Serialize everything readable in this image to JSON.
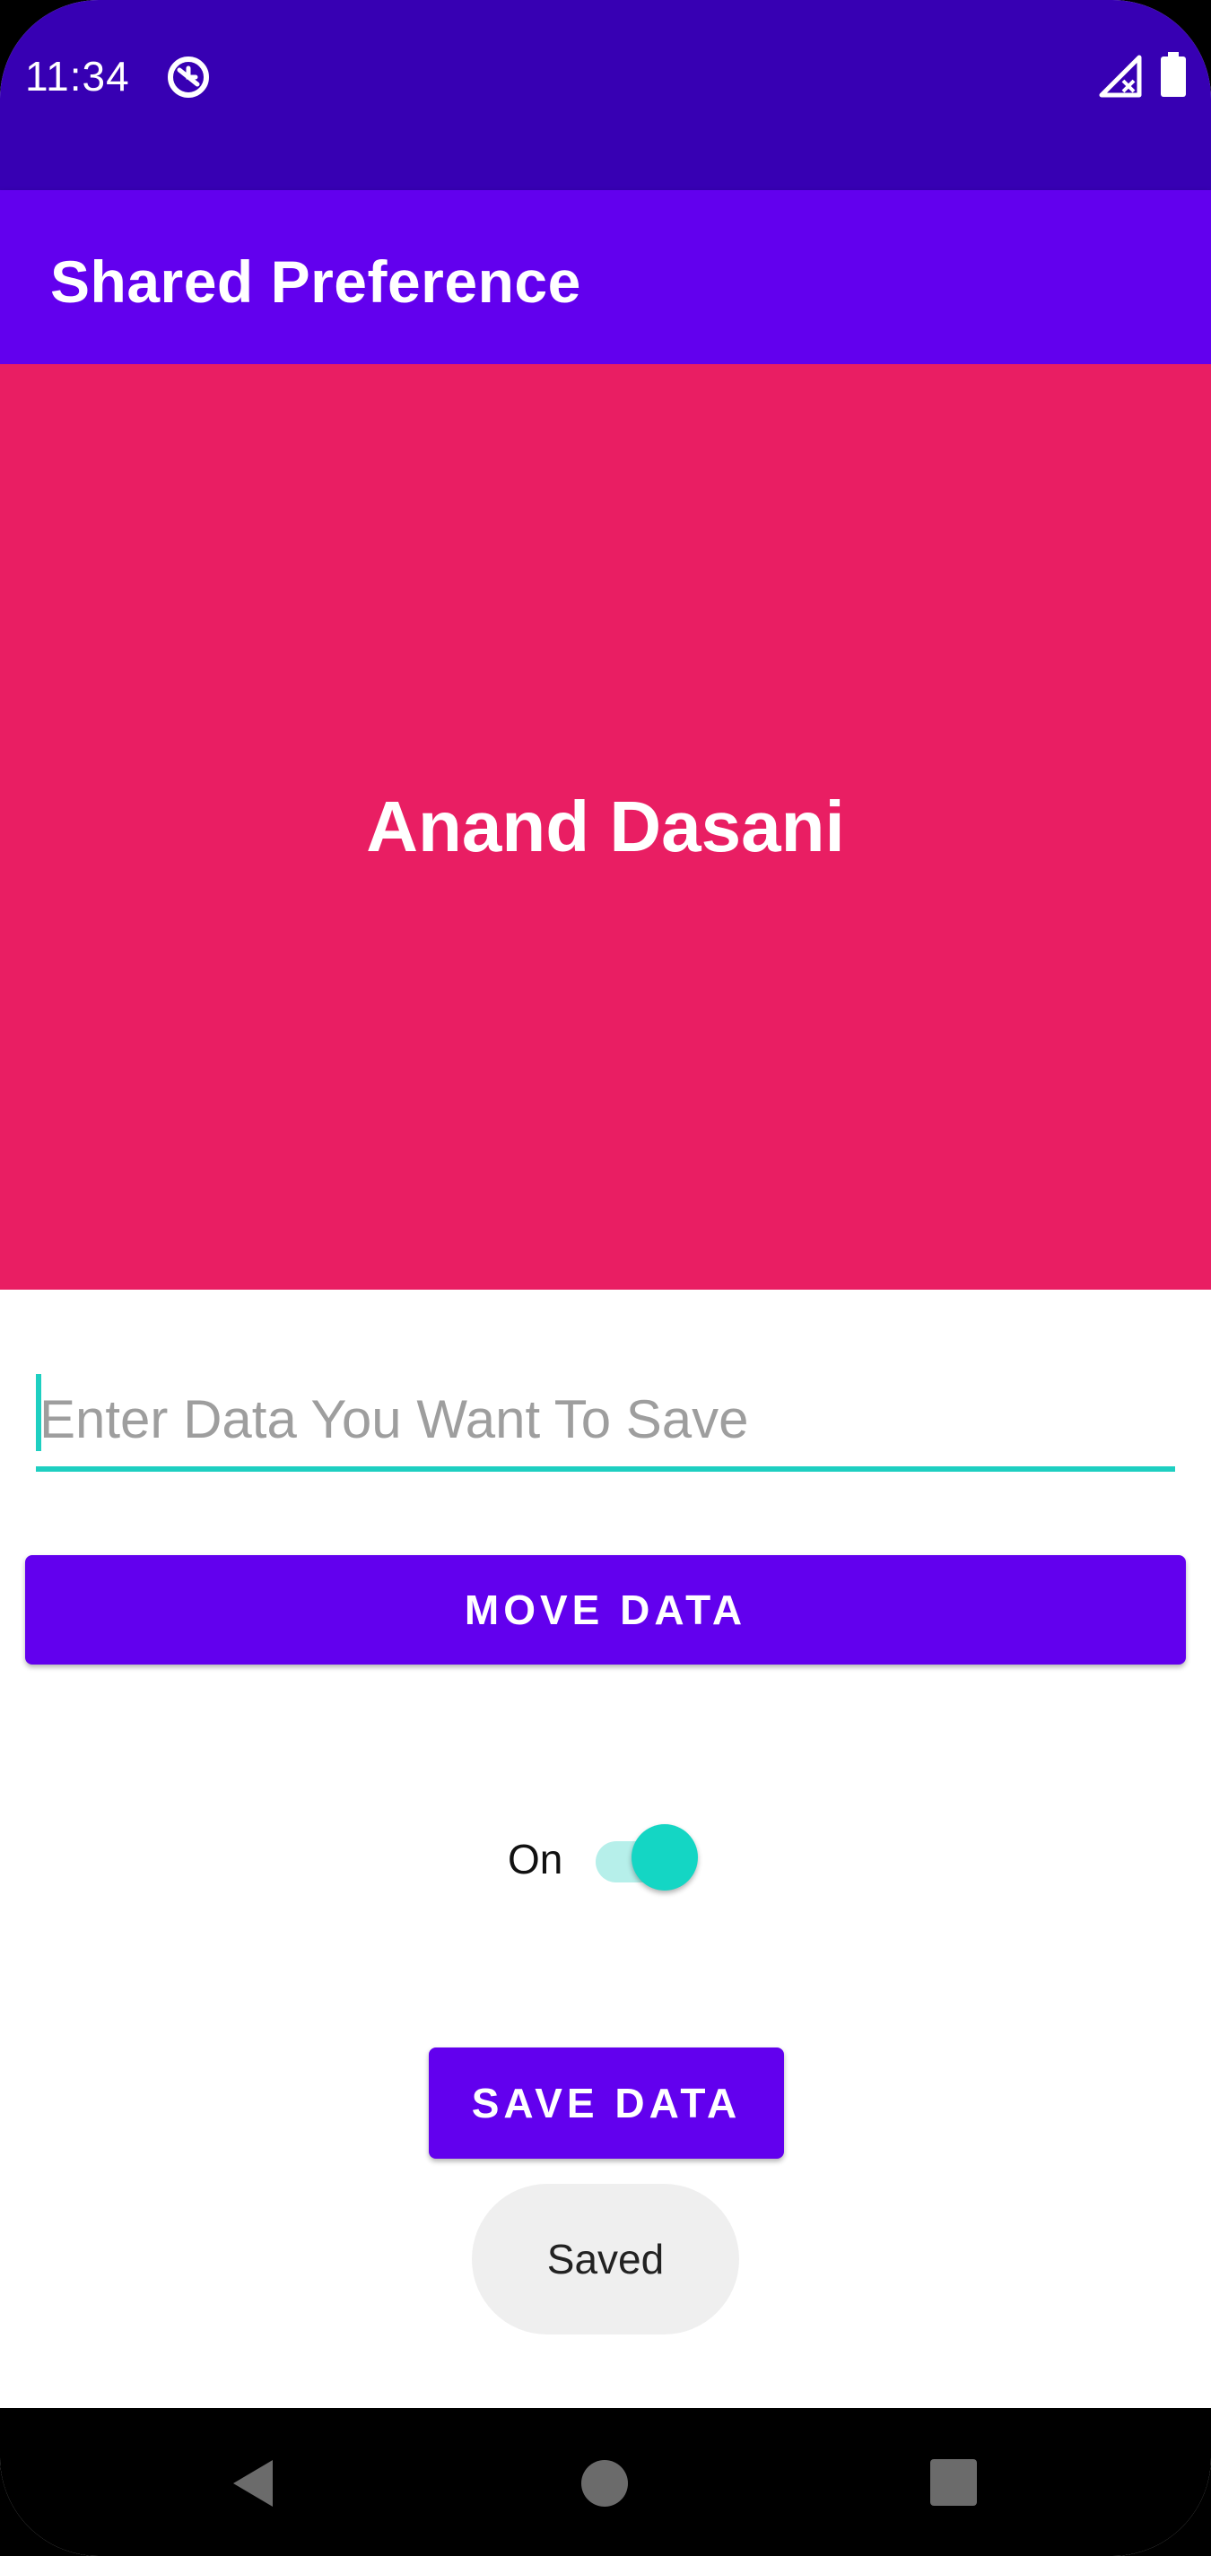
{
  "status_bar": {
    "time": "11:34",
    "icons": [
      "app-notification-icon",
      "signal-no-data-icon",
      "battery-icon"
    ]
  },
  "app_bar": {
    "title": "Shared Preference",
    "color": "#6200EE"
  },
  "hero": {
    "name": "Anand Dasani",
    "background_color": "#E91E63"
  },
  "data_input": {
    "value": "",
    "placeholder": "Enter Data You Want To Save",
    "accent_color": "#1ECFC1"
  },
  "buttons": {
    "move_label": "MOVE DATA",
    "save_label": "SAVE DATA",
    "color": "#6200EE"
  },
  "switch": {
    "label": "On",
    "checked": true,
    "thumb_color": "#14D6C4"
  },
  "toast": {
    "text": "Saved"
  },
  "nav_bar": {
    "icons": [
      "back-icon",
      "home-icon",
      "recents-icon"
    ]
  }
}
